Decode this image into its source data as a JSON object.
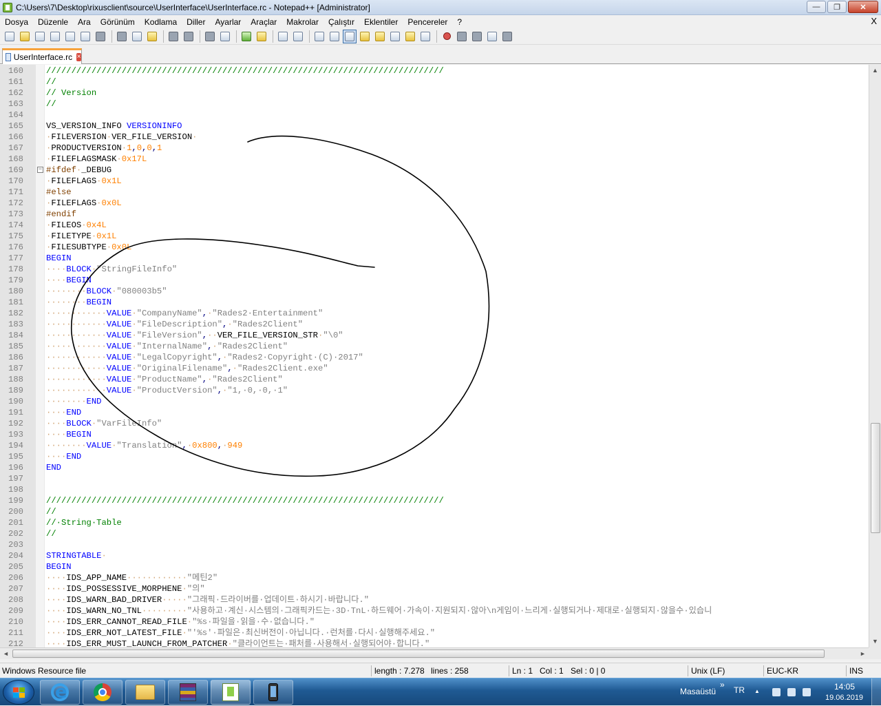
{
  "window": {
    "title": "C:\\Users\\7\\Desktop\\rixusclient\\source\\UserInterface\\UserInterface.rc - Notepad++ [Administrator]",
    "minimize": "—",
    "maximize": "❐",
    "close": "✕"
  },
  "menu": {
    "items": [
      "Dosya",
      "Düzenle",
      "Ara",
      "Görünüm",
      "Kodlama",
      "Diller",
      "Ayarlar",
      "Araçlar",
      "Makrolar",
      "Çalıştır",
      "Eklentiler",
      "Pencereler",
      "?"
    ],
    "close_label": "X"
  },
  "toolbar": {
    "icons": [
      "new-icon",
      "open-icon",
      "save-icon",
      "save-all-icon",
      "close-icon",
      "close-all-icon",
      "print-icon",
      "cut-icon",
      "copy-icon",
      "paste-icon",
      "undo-icon",
      "redo-icon",
      "find-icon",
      "replace-icon",
      "zoom-in-icon",
      "zoom-out-icon",
      "sync-v-icon",
      "sync-h-icon",
      "word-wrap-icon",
      "show-all-chars-icon",
      "indent-guide-icon",
      "udl-icon",
      "doc-map-icon",
      "function-list-icon",
      "folder-workspace-icon",
      "monitor-icon",
      "record-macro-icon",
      "stop-macro-icon",
      "play-macro-icon",
      "run-macro-multiple-icon",
      "save-macro-icon"
    ]
  },
  "tabs": [
    {
      "label": "UserInterface.rc",
      "close": "×",
      "active": true
    }
  ],
  "editor": {
    "lines": [
      {
        "n": "160",
        "segs": [
          [
            "c-comment",
            "///////////////////////////////////////////////////////////////////////////////"
          ]
        ]
      },
      {
        "n": "161",
        "segs": [
          [
            "c-comment",
            "//"
          ]
        ]
      },
      {
        "n": "162",
        "segs": [
          [
            "c-comment",
            "// Version"
          ]
        ]
      },
      {
        "n": "163",
        "segs": [
          [
            "c-comment",
            "//"
          ]
        ]
      },
      {
        "n": "164",
        "segs": []
      },
      {
        "n": "165",
        "segs": [
          [
            "",
            "VS_VERSION_INFO "
          ],
          [
            "c-kw",
            "VERSIONINFO"
          ]
        ]
      },
      {
        "n": "166",
        "segs": [
          [
            "ws",
            "·"
          ],
          [
            "",
            "FILEVERSION"
          ],
          [
            "ws",
            "·"
          ],
          [
            "",
            "VER_FILE_VERSION"
          ],
          [
            "ws",
            "·"
          ]
        ]
      },
      {
        "n": "167",
        "segs": [
          [
            "ws",
            "·"
          ],
          [
            "",
            "PRODUCTVERSION"
          ],
          [
            "ws",
            "·"
          ],
          [
            "c-num",
            "1"
          ],
          [
            "c-op",
            ","
          ],
          [
            "c-num",
            "0"
          ],
          [
            "c-op",
            ","
          ],
          [
            "c-num",
            "0"
          ],
          [
            "c-op",
            ","
          ],
          [
            "c-num",
            "1"
          ]
        ]
      },
      {
        "n": "168",
        "segs": [
          [
            "ws",
            "·"
          ],
          [
            "",
            "FILEFLAGSMASK"
          ],
          [
            "ws",
            "·"
          ],
          [
            "c-num",
            "0x17L"
          ]
        ]
      },
      {
        "n": "169",
        "fold": "−",
        "segs": [
          [
            "c-pre",
            "#ifdef"
          ],
          [
            "ws",
            "·"
          ],
          [
            "",
            "_DEBUG"
          ]
        ]
      },
      {
        "n": "170",
        "segs": [
          [
            "ws",
            "·"
          ],
          [
            "",
            "FILEFLAGS"
          ],
          [
            "ws",
            "·"
          ],
          [
            "c-num",
            "0x1L"
          ]
        ]
      },
      {
        "n": "171",
        "segs": [
          [
            "c-pre",
            "#else"
          ]
        ]
      },
      {
        "n": "172",
        "segs": [
          [
            "ws",
            "·"
          ],
          [
            "",
            "FILEFLAGS"
          ],
          [
            "ws",
            "·"
          ],
          [
            "c-num",
            "0x0L"
          ]
        ]
      },
      {
        "n": "173",
        "segs": [
          [
            "c-pre",
            "#endif"
          ]
        ]
      },
      {
        "n": "174",
        "segs": [
          [
            "ws",
            "·"
          ],
          [
            "",
            "FILEOS"
          ],
          [
            "ws",
            "·"
          ],
          [
            "c-num",
            "0x4L"
          ]
        ]
      },
      {
        "n": "175",
        "segs": [
          [
            "ws",
            "·"
          ],
          [
            "",
            "FILETYPE"
          ],
          [
            "ws",
            "·"
          ],
          [
            "c-num",
            "0x1L"
          ]
        ]
      },
      {
        "n": "176",
        "segs": [
          [
            "ws",
            "·"
          ],
          [
            "",
            "FILESUBTYPE"
          ],
          [
            "ws",
            "·"
          ],
          [
            "c-num",
            "0x0L"
          ]
        ]
      },
      {
        "n": "177",
        "segs": [
          [
            "c-kw",
            "BEGIN"
          ]
        ]
      },
      {
        "n": "178",
        "segs": [
          [
            "ws",
            "····"
          ],
          [
            "c-kw",
            "BLOCK"
          ],
          [
            "ws",
            "·"
          ],
          [
            "c-str",
            "\"StringFileInfo\""
          ]
        ]
      },
      {
        "n": "179",
        "segs": [
          [
            "ws",
            "····"
          ],
          [
            "c-kw",
            "BEGIN"
          ]
        ]
      },
      {
        "n": "180",
        "segs": [
          [
            "ws",
            "········"
          ],
          [
            "c-kw",
            "BLOCK"
          ],
          [
            "ws",
            "·"
          ],
          [
            "c-str",
            "\"080003b5\""
          ]
        ]
      },
      {
        "n": "181",
        "segs": [
          [
            "ws",
            "········"
          ],
          [
            "c-kw",
            "BEGIN"
          ]
        ]
      },
      {
        "n": "182",
        "segs": [
          [
            "ws",
            "············"
          ],
          [
            "c-kw",
            "VALUE"
          ],
          [
            "ws",
            "·"
          ],
          [
            "c-str",
            "\"CompanyName\""
          ],
          [
            "c-op",
            ","
          ],
          [
            "ws",
            "·"
          ],
          [
            "c-str",
            "\"Rades2·Entertainment\""
          ]
        ]
      },
      {
        "n": "183",
        "segs": [
          [
            "ws",
            "············"
          ],
          [
            "c-kw",
            "VALUE"
          ],
          [
            "ws",
            "·"
          ],
          [
            "c-str",
            "\"FileDescription\""
          ],
          [
            "c-op",
            ","
          ],
          [
            "ws",
            "·"
          ],
          [
            "c-str",
            "\"Rades2Client\""
          ]
        ]
      },
      {
        "n": "184",
        "segs": [
          [
            "ws",
            "············"
          ],
          [
            "c-kw",
            "VALUE"
          ],
          [
            "ws",
            "·"
          ],
          [
            "c-str",
            "\"FileVersion\""
          ],
          [
            "c-op",
            ","
          ],
          [
            "ws",
            "··"
          ],
          [
            "",
            "VER_FILE_VERSION_STR"
          ],
          [
            "ws",
            "·"
          ],
          [
            "c-str",
            "\"\\0\""
          ]
        ]
      },
      {
        "n": "185",
        "segs": [
          [
            "ws",
            "············"
          ],
          [
            "c-kw",
            "VALUE"
          ],
          [
            "ws",
            "·"
          ],
          [
            "c-str",
            "\"InternalName\""
          ],
          [
            "c-op",
            ","
          ],
          [
            "ws",
            "·"
          ],
          [
            "c-str",
            "\"Rades2Client\""
          ]
        ]
      },
      {
        "n": "186",
        "segs": [
          [
            "ws",
            "············"
          ],
          [
            "c-kw",
            "VALUE"
          ],
          [
            "ws",
            "·"
          ],
          [
            "c-str",
            "\"LegalCopyright\""
          ],
          [
            "c-op",
            ","
          ],
          [
            "ws",
            "·"
          ],
          [
            "c-str",
            "\"Rades2·Copyright·(C)·2017\""
          ]
        ]
      },
      {
        "n": "187",
        "segs": [
          [
            "ws",
            "············"
          ],
          [
            "c-kw",
            "VALUE"
          ],
          [
            "ws",
            "·"
          ],
          [
            "c-str",
            "\"OriginalFilename\""
          ],
          [
            "c-op",
            ","
          ],
          [
            "ws",
            "·"
          ],
          [
            "c-str",
            "\"Rades2Client.exe\""
          ]
        ]
      },
      {
        "n": "188",
        "segs": [
          [
            "ws",
            "············"
          ],
          [
            "c-kw",
            "VALUE"
          ],
          [
            "ws",
            "·"
          ],
          [
            "c-str",
            "\"ProductName\""
          ],
          [
            "c-op",
            ","
          ],
          [
            "ws",
            "·"
          ],
          [
            "c-str",
            "\"Rades2Client\""
          ]
        ]
      },
      {
        "n": "189",
        "segs": [
          [
            "ws",
            "············"
          ],
          [
            "c-kw",
            "VALUE"
          ],
          [
            "ws",
            "·"
          ],
          [
            "c-str",
            "\"ProductVersion\""
          ],
          [
            "c-op",
            ","
          ],
          [
            "ws",
            "·"
          ],
          [
            "c-str",
            "\"1,·0,·0,·1\""
          ]
        ]
      },
      {
        "n": "190",
        "segs": [
          [
            "ws",
            "········"
          ],
          [
            "c-kw",
            "END"
          ]
        ]
      },
      {
        "n": "191",
        "segs": [
          [
            "ws",
            "····"
          ],
          [
            "c-kw",
            "END"
          ]
        ]
      },
      {
        "n": "192",
        "segs": [
          [
            "ws",
            "····"
          ],
          [
            "c-kw",
            "BLOCK"
          ],
          [
            "ws",
            "·"
          ],
          [
            "c-str",
            "\"VarFileInfo\""
          ]
        ]
      },
      {
        "n": "193",
        "segs": [
          [
            "ws",
            "····"
          ],
          [
            "c-kw",
            "BEGIN"
          ]
        ]
      },
      {
        "n": "194",
        "segs": [
          [
            "ws",
            "········"
          ],
          [
            "c-kw",
            "VALUE"
          ],
          [
            "ws",
            "·"
          ],
          [
            "c-str",
            "\"Translation\""
          ],
          [
            "c-op",
            ","
          ],
          [
            "ws",
            "·"
          ],
          [
            "c-num",
            "0x800"
          ],
          [
            "c-op",
            ","
          ],
          [
            "ws",
            "·"
          ],
          [
            "c-num",
            "949"
          ]
        ]
      },
      {
        "n": "195",
        "segs": [
          [
            "ws",
            "····"
          ],
          [
            "c-kw",
            "END"
          ]
        ]
      },
      {
        "n": "196",
        "segs": [
          [
            "c-kw",
            "END"
          ]
        ]
      },
      {
        "n": "197",
        "segs": []
      },
      {
        "n": "198",
        "segs": []
      },
      {
        "n": "199",
        "segs": [
          [
            "c-comment",
            "///////////////////////////////////////////////////////////////////////////////"
          ]
        ]
      },
      {
        "n": "200",
        "segs": [
          [
            "c-comment",
            "//"
          ]
        ]
      },
      {
        "n": "201",
        "segs": [
          [
            "c-comment",
            "//·String·Table"
          ]
        ]
      },
      {
        "n": "202",
        "segs": [
          [
            "c-comment",
            "//"
          ]
        ]
      },
      {
        "n": "203",
        "segs": []
      },
      {
        "n": "204",
        "segs": [
          [
            "c-kw",
            "STRINGTABLE"
          ],
          [
            "ws",
            "·"
          ]
        ]
      },
      {
        "n": "205",
        "segs": [
          [
            "c-kw",
            "BEGIN"
          ]
        ]
      },
      {
        "n": "206",
        "segs": [
          [
            "ws",
            "····"
          ],
          [
            "",
            "IDS_APP_NAME"
          ],
          [
            "ws",
            "············"
          ],
          [
            "c-str",
            "\"메틴2\""
          ]
        ]
      },
      {
        "n": "207",
        "segs": [
          [
            "ws",
            "····"
          ],
          [
            "",
            "IDS_POSSESSIVE_MORPHENE"
          ],
          [
            "ws",
            "·"
          ],
          [
            "c-str",
            "\"의\""
          ]
        ]
      },
      {
        "n": "208",
        "segs": [
          [
            "ws",
            "····"
          ],
          [
            "",
            "IDS_WARN_BAD_DRIVER"
          ],
          [
            "ws",
            "·····"
          ],
          [
            "c-str",
            "\"그래픽·드라이버를·업데이트·하시기·바랍니다.\""
          ]
        ]
      },
      {
        "n": "209",
        "segs": [
          [
            "ws",
            "····"
          ],
          [
            "",
            "IDS_WARN_NO_TNL"
          ],
          [
            "ws",
            "·········"
          ],
          [
            "c-str",
            "\"사용하고·계신·시스템의·그래픽카드는·3D·TnL·하드웨어·가속이·지원되지·않아\\n게임이·느리게·실행되거나·제대로·실행되지·않을수·있습니"
          ]
        ]
      },
      {
        "n": "210",
        "segs": [
          [
            "ws",
            "····"
          ],
          [
            "",
            "IDS_ERR_CANNOT_READ_FILE"
          ],
          [
            "ws",
            "·"
          ],
          [
            "c-str",
            "\"%s·파일을·읽을·수·없습니다.\""
          ]
        ]
      },
      {
        "n": "211",
        "segs": [
          [
            "ws",
            "····"
          ],
          [
            "",
            "IDS_ERR_NOT_LATEST_FILE"
          ],
          [
            "ws",
            "·"
          ],
          [
            "c-str",
            "\"'%s'·파일은·최신버전이·아닙니다.·런처를·다시·실행해주세요.\""
          ]
        ]
      },
      {
        "n": "212",
        "segs": [
          [
            "ws",
            "····"
          ],
          [
            "",
            "IDS_ERR_MUST_LAUNCH_FROM_PATCHER"
          ],
          [
            "ws",
            "·"
          ],
          [
            "c-str",
            "\"클라이언트는·패처를·사용해서·실행되어야·합니다.\""
          ]
        ]
      }
    ]
  },
  "scroll": {
    "up": "▲",
    "down": "▼",
    "left": "◄",
    "right": "►",
    "grip": "≡",
    "hgrip": "⦀"
  },
  "statusbar": {
    "language": "Windows Resource file",
    "length": "length : 7.278",
    "lines": "lines : 258",
    "ln": "Ln : 1",
    "col": "Col : 1",
    "sel": "Sel : 0 | 0",
    "eol": "Unix (LF)",
    "encoding": "EUC-KR",
    "mode": "INS"
  },
  "taskbar": {
    "apps": [
      "internet-explorer-icon",
      "chrome-icon",
      "explorer-icon",
      "winrar-icon",
      "notepadpp-icon",
      "phone-icon"
    ],
    "desktop_label": "Masaüstü",
    "chevron": "»",
    "lang": "TR",
    "up_arrow": "▲",
    "time": "14:05",
    "date": "19.06.2019"
  }
}
